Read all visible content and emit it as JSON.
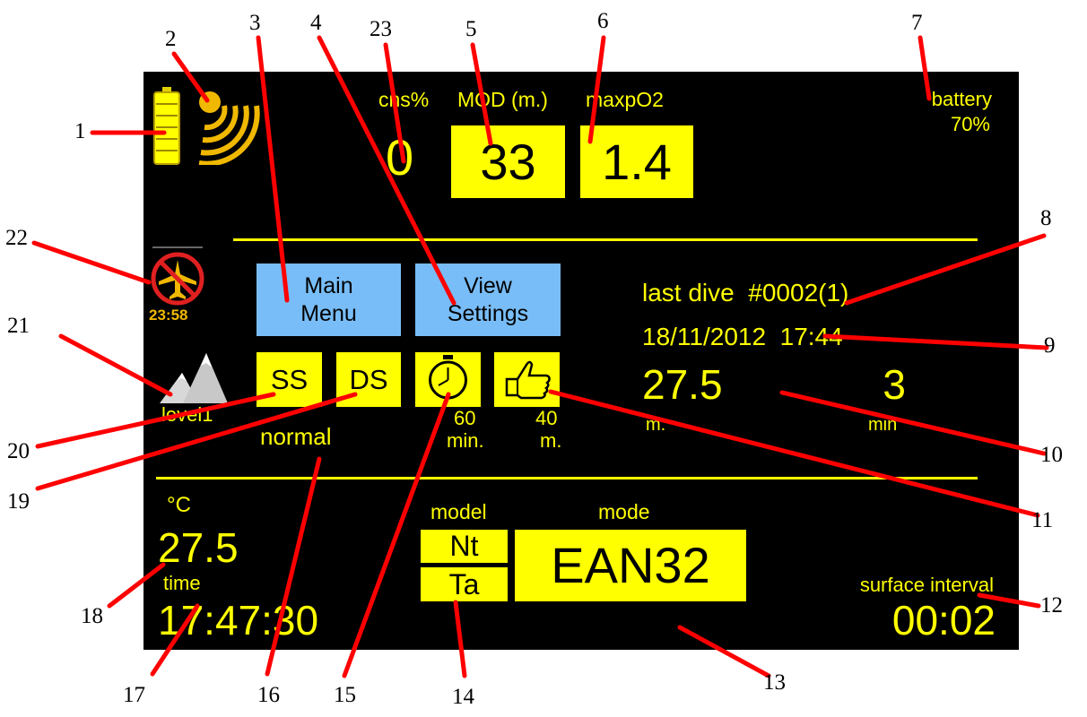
{
  "top": {
    "cns_label": "cns%",
    "cns_value": "0",
    "mod_label": "MOD (m.)",
    "mod_value": "33",
    "maxpo2_label": "maxpO2",
    "maxpo2_value": "1.4",
    "battery_label": "battery",
    "battery_value": "70%"
  },
  "middle": {
    "no_fly_time": "23:58",
    "main_menu_line1": "Main",
    "main_menu_line2": "Menu",
    "view_settings_line1": "View",
    "view_settings_line2": "Settings",
    "ss_label": "SS",
    "ds_label": "DS",
    "level_label": "level1",
    "profile_label": "normal",
    "time_limit_value": "60",
    "time_limit_unit": "min.",
    "depth_limit_value": "40",
    "depth_limit_unit": "m."
  },
  "last_dive": {
    "title": "last dive  #0002(1)",
    "datetime": "18/11/2012  17:44",
    "depth": "27.5",
    "duration": "3",
    "depth_unit": "m.",
    "duration_unit": "min"
  },
  "bottom": {
    "temp_unit": "°C",
    "temp_value": "27.5",
    "time_label": "time",
    "time_value": "17:47:30",
    "model_label": "model",
    "model_top": "Nt",
    "model_bottom": "Ta",
    "mode_label": "mode",
    "mode_value": "EAN32",
    "surface_label": "surface interval",
    "surface_value": "00:02"
  },
  "callouts": [
    "1",
    "2",
    "3",
    "4",
    "23",
    "5",
    "6",
    "7",
    "8",
    "9",
    "10",
    "11",
    "12",
    "13",
    "14",
    "15",
    "16",
    "17",
    "18",
    "19",
    "20",
    "21",
    "22"
  ],
  "colors": {
    "screen": "#000000",
    "accent": "#ffff00",
    "button": "#78bdf7",
    "callout_line": "#ff0000"
  },
  "icons": [
    "battery-icon",
    "signal-icon",
    "no-fly-icon",
    "altitude-mountain-icon",
    "stopwatch-icon",
    "thumbs-up-icon"
  ]
}
